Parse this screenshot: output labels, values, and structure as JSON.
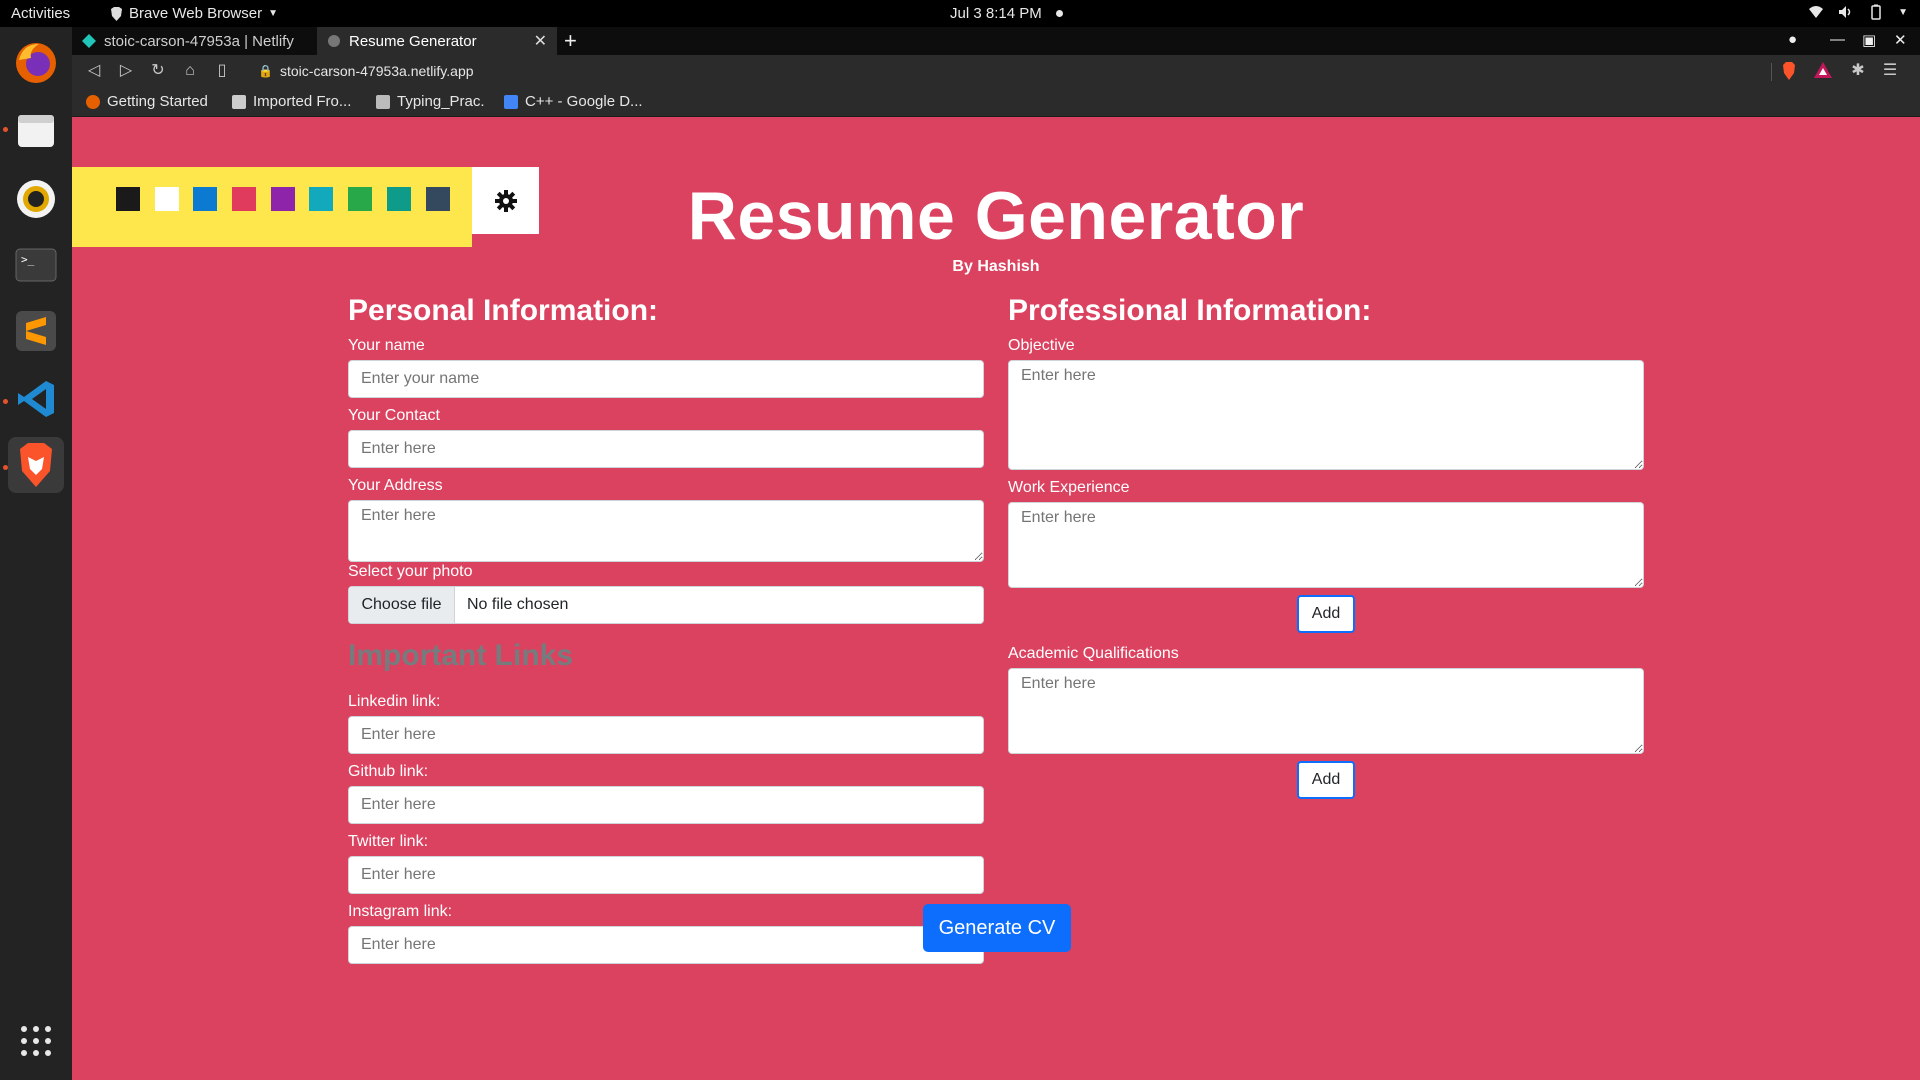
{
  "topbar": {
    "activities": "Activities",
    "app_name": "Brave Web Browser",
    "clock": "Jul 3  8:14 PM"
  },
  "dock": {
    "items": [
      "firefox",
      "files",
      "rhythmbox",
      "terminal",
      "sublime-text",
      "vscode",
      "brave"
    ]
  },
  "browser": {
    "tabs": [
      {
        "label": "stoic-carson-47953a | Netlify"
      },
      {
        "label": "Resume Generator"
      }
    ],
    "url": "stoic-carson-47953a.netlify.app",
    "bookmarks": [
      {
        "label": "Getting Started"
      },
      {
        "label": "Imported Fro..."
      },
      {
        "label": "Typing_Prac."
      },
      {
        "label": "C++ - Google D..."
      }
    ]
  },
  "palette": {
    "colors": [
      "#1a1a1a",
      "#ffffff",
      "#0d7ad1",
      "#e03a5c",
      "#8e24aa",
      "#13a9bd",
      "#29a84a",
      "#0e9b8a",
      "#34495e"
    ]
  },
  "header": {
    "title": "Resume Generator",
    "byline": "By Hashish"
  },
  "personal": {
    "heading": "Personal Information:",
    "name_label": "Your name",
    "name_placeholder": "Enter your name",
    "contact_label": "Your Contact",
    "contact_placeholder": "Enter here",
    "address_label": "Your Address",
    "address_placeholder": "Enter here",
    "photo_label": "Select your photo",
    "photo_button": "Choose file",
    "photo_status": "No file chosen"
  },
  "links": {
    "heading": "Important Links",
    "linkedin_label": "Linkedin link:",
    "linkedin_placeholder": "Enter here",
    "github_label": "Github link:",
    "github_placeholder": "Enter here",
    "twitter_label": "Twitter link:",
    "twitter_placeholder": "Enter here",
    "instagram_label": "Instagram link:",
    "instagram_placeholder": "Enter here"
  },
  "professional": {
    "heading": "Professional Information:",
    "objective_label": "Objective",
    "objective_placeholder": "Enter here",
    "work_label": "Work Experience",
    "work_placeholder": "Enter here",
    "work_add": "Add",
    "academic_label": "Academic Qualifications",
    "academic_placeholder": "Enter here",
    "academic_add": "Add"
  },
  "generate_label": "Generate CV",
  "colors": {
    "page_bg": "#db4260",
    "palette_bg": "#fde74c",
    "primary": "#0d6efd"
  }
}
